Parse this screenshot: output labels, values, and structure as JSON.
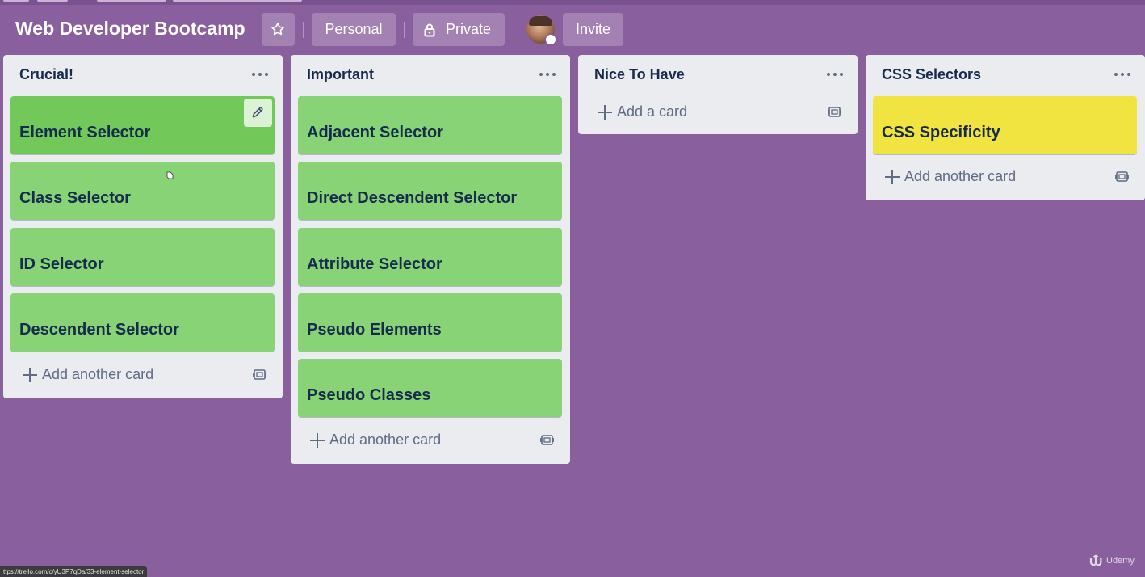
{
  "board": {
    "title": "Web Developer Bootcamp",
    "visibility_team": "Personal",
    "visibility_privacy": "Private",
    "invite_label": "Invite"
  },
  "colors": {
    "board_background": "#8a5f9e",
    "list_background": "#ebecf0",
    "card_green": "#88d375",
    "card_green_hover": "#72c95a",
    "card_yellow": "#f1e340",
    "text_dark": "#172b4d"
  },
  "lists": [
    {
      "title": "Crucial!",
      "cards": [
        "Element Selector",
        "Class Selector",
        "ID Selector",
        "Descendent Selector"
      ],
      "add_label": "Add another card"
    },
    {
      "title": "Important",
      "cards": [
        "Adjacent Selector",
        "Direct Descendent Selector",
        "Attribute Selector",
        "Pseudo Elements",
        "Pseudo Classes"
      ],
      "add_label": "Add another card"
    },
    {
      "title": "Nice To Have",
      "cards": [],
      "add_label": "Add a card"
    },
    {
      "title": "CSS Selectors",
      "cards": [
        "CSS Specificity"
      ],
      "add_label": "Add another card"
    }
  ],
  "status_url": "ttps://trello.com/c/yU3P7qDa/33-element-selector",
  "watermark": "Udemy",
  "icons": {
    "star": "star-icon",
    "lock": "lock-icon",
    "menu": "ellipsis-icon",
    "edit": "pencil-icon",
    "add": "plus-icon",
    "template": "card-template-icon"
  }
}
